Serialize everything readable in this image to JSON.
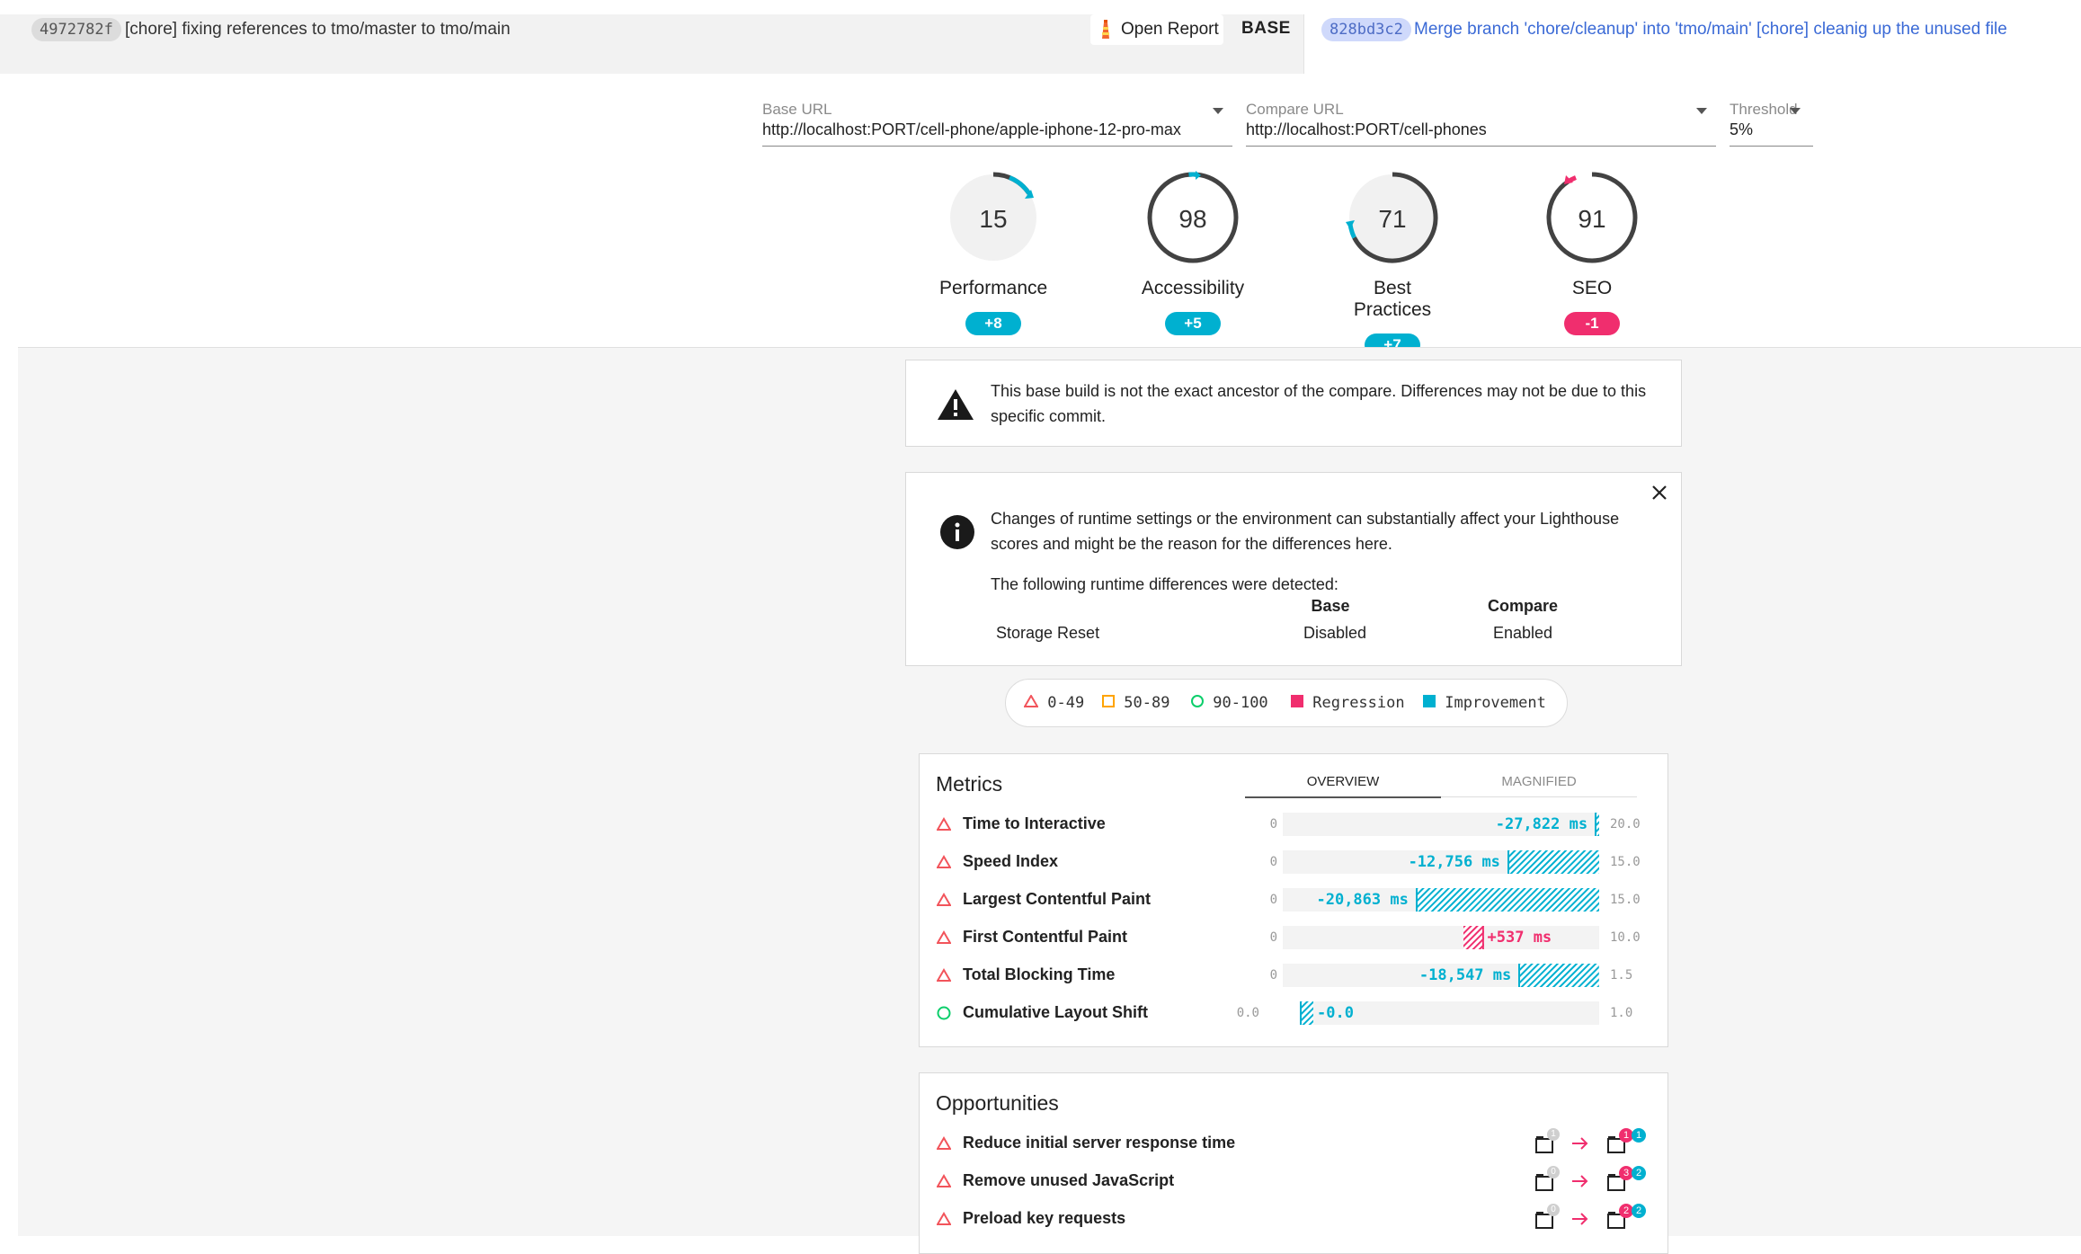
{
  "header": {
    "base_hash": "4972782f",
    "base_message": "[chore] fixing references to tmo/master to tmo/main",
    "open_report_label": "Open Report",
    "base_label": "BASE",
    "compare_hash": "828bd3c2",
    "compare_message": "Merge branch 'chore/cleanup' into 'tmo/main' [chore] cleanig up the unused file"
  },
  "controls": {
    "base_url": {
      "label": "Base URL",
      "value": "http://localhost:PORT/cell-phone/apple-iphone-12-pro-max"
    },
    "compare_url": {
      "label": "Compare URL",
      "value": "http://localhost:PORT/cell-phones"
    },
    "threshold": {
      "label": "Threshold",
      "value": "5%"
    }
  },
  "scores": [
    {
      "name": "Performance",
      "score": "15",
      "delta": "+8",
      "color": "#00b0d0"
    },
    {
      "name": "Accessibility",
      "score": "98",
      "delta": "+5",
      "color": "#00b0d0"
    },
    {
      "name": "Best Practices",
      "score": "71",
      "delta": "+7",
      "color": "#00b0d0"
    },
    {
      "name": "SEO",
      "score": "91",
      "delta": "-1",
      "color": "#f02e6e"
    }
  ],
  "warning": {
    "text": "This base build is not the exact ancestor of the compare. Differences may not be due to this specific commit."
  },
  "runtime_notice": {
    "text": "Changes of runtime settings or the environment can substantially affect your Lighthouse scores and might be the reason for the differences here.",
    "detected_label": "The following runtime differences were detected:",
    "columns": [
      "Base",
      "Compare"
    ],
    "rows": [
      {
        "setting": "Storage Reset",
        "base": "Disabled",
        "compare": "Enabled"
      }
    ]
  },
  "legend": {
    "items": [
      "0-49",
      "50-89",
      "90-100",
      "Regression",
      "Improvement"
    ],
    "colors": {
      "fail": "#f2545b",
      "average": "#ffa400",
      "pass": "#0cce6b",
      "regression": "#f02e6e",
      "improvement": "#00b0d0"
    }
  },
  "metrics": {
    "title": "Metrics",
    "tabs": [
      "OVERVIEW",
      "MAGNIFIED"
    ],
    "rows": [
      {
        "name": "Time to Interactive",
        "status": "fail",
        "min": "0",
        "max": "20.0",
        "delta": "-27,822 ms",
        "type": "improvement",
        "bar_start": 0.986,
        "bar_end": 1.0
      },
      {
        "name": "Speed Index",
        "status": "fail",
        "min": "0",
        "max": "15.0",
        "delta": "-12,756 ms",
        "type": "improvement",
        "bar_start": 0.71,
        "bar_end": 1.0
      },
      {
        "name": "Largest Contentful Paint",
        "status": "fail",
        "min": "0",
        "max": "15.0",
        "delta": "-20,863 ms",
        "type": "improvement",
        "bar_start": 0.42,
        "bar_end": 1.0
      },
      {
        "name": "First Contentful Paint",
        "status": "fail",
        "min": "0",
        "max": "10.0",
        "delta": "+537 ms",
        "type": "regression",
        "bar_start": 0.57,
        "bar_end": 0.635
      },
      {
        "name": "Total Blocking Time",
        "status": "fail",
        "min": "0",
        "max": "1.5",
        "delta": "-18,547 ms",
        "type": "improvement",
        "bar_start": 0.745,
        "bar_end": 1.0
      },
      {
        "name": "Cumulative Layout Shift",
        "status": "pass",
        "min": "0.0",
        "max": "1.0",
        "delta": "-0.0",
        "type": "improvement",
        "bar_start": 0.0,
        "bar_end": 0.045
      }
    ]
  },
  "opportunities": {
    "title": "Opportunities",
    "rows": [
      {
        "name": "Reduce initial server response time",
        "base_count": "1",
        "compare_regress": "1",
        "compare_improve": "1"
      },
      {
        "name": "Remove unused JavaScript",
        "base_count": "0",
        "compare_regress": "3",
        "compare_improve": "2"
      },
      {
        "name": "Preload key requests",
        "base_count": "0",
        "compare_regress": "2",
        "compare_improve": "2"
      }
    ]
  }
}
